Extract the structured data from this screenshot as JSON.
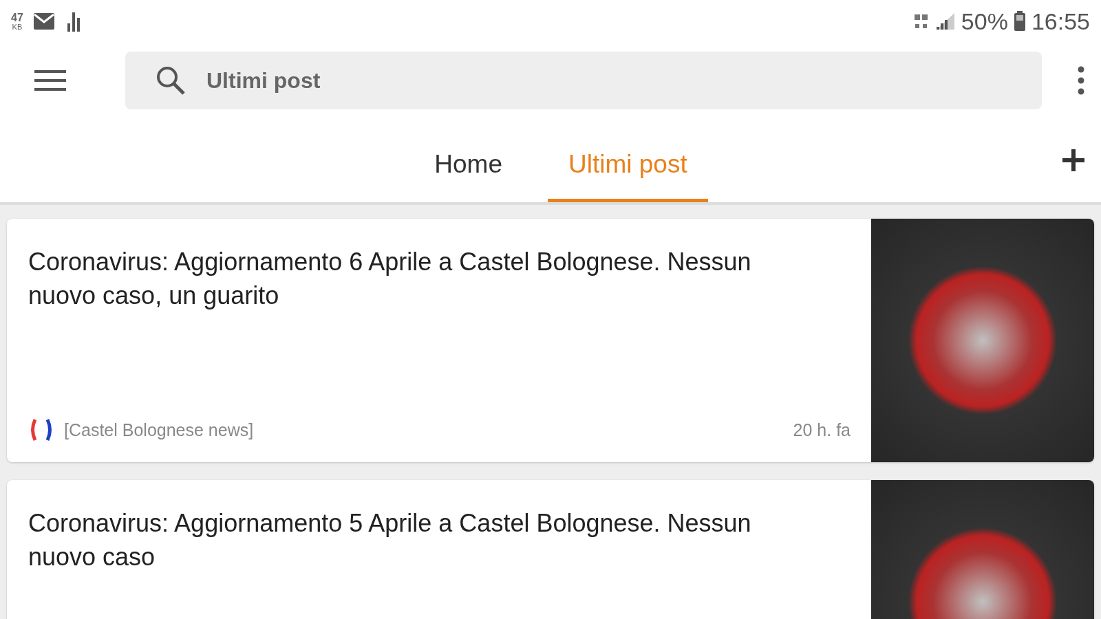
{
  "status_bar": {
    "net_speed_value": "47",
    "net_speed_unit": "KB",
    "battery": "50%",
    "time": "16:55"
  },
  "search": {
    "placeholder": "Ultimi post"
  },
  "tabs": [
    {
      "label": "Home",
      "selected": false
    },
    {
      "label": "Ultimi post",
      "selected": true
    }
  ],
  "posts": [
    {
      "title": "Coronavirus: Aggiornamento 6 Aprile a Castel Bolognese. Nessun nuovo caso, un guarito",
      "source": "[Castel Bolognese news]",
      "time": "20 h. fa"
    },
    {
      "title": "Coronavirus: Aggiornamento 5 Aprile a Castel Bolognese. Nessun nuovo caso"
    }
  ]
}
